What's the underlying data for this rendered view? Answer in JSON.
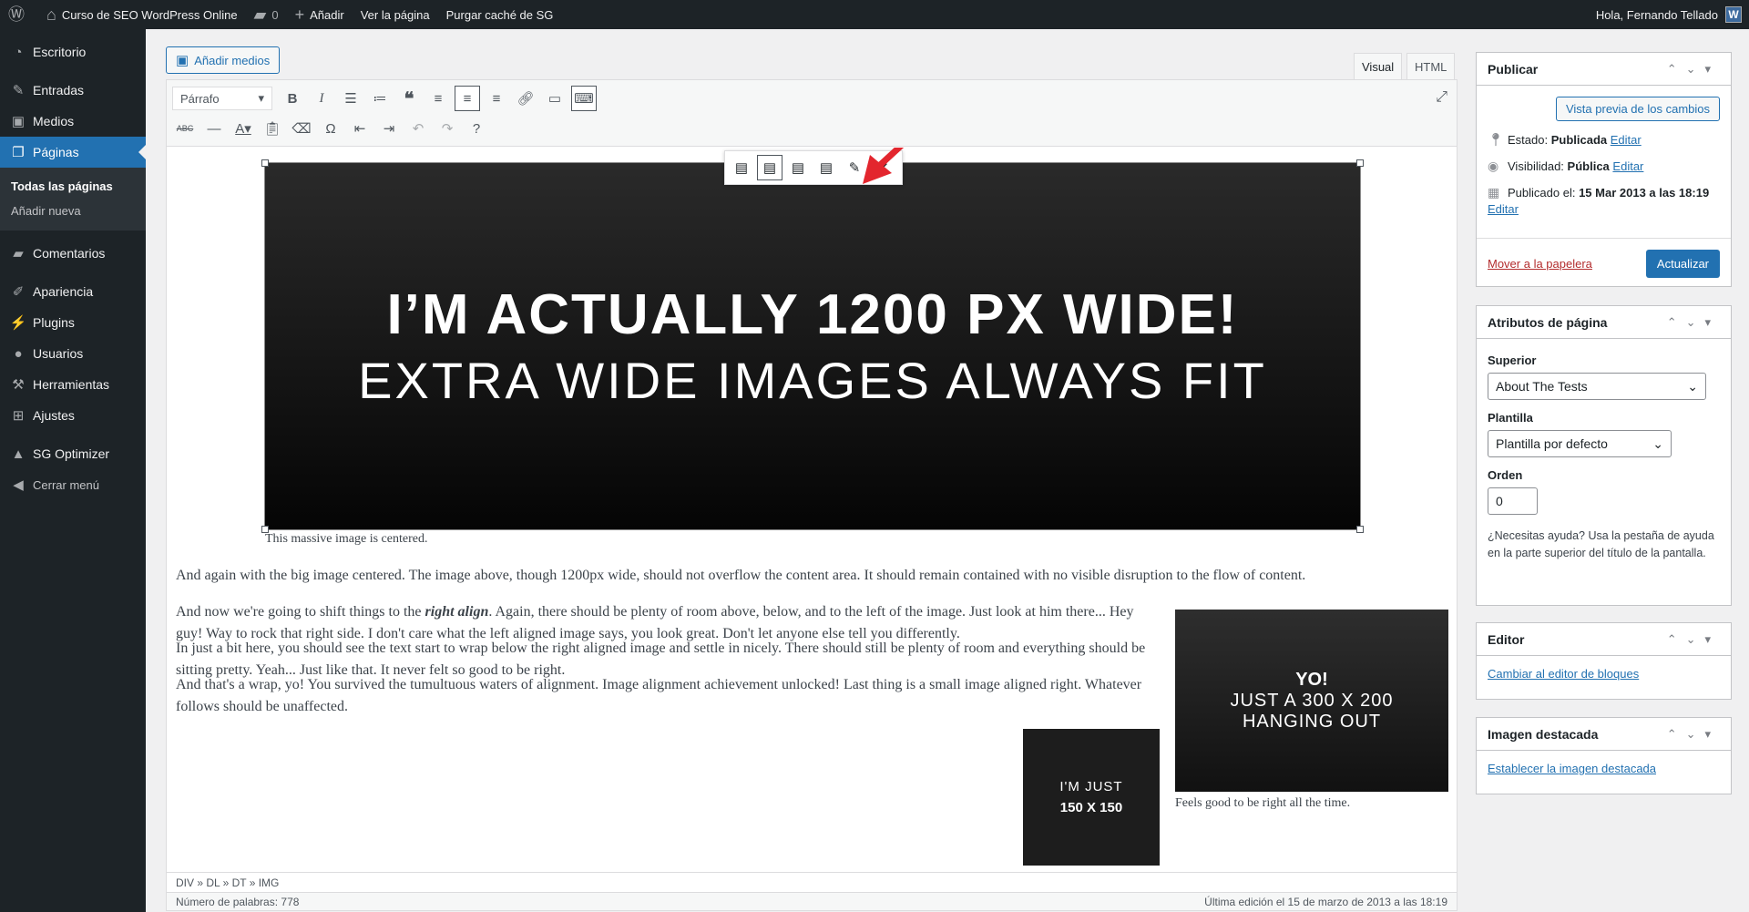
{
  "adminbar": {
    "site_name": "Curso de SEO WordPress Online",
    "comments_count": "0",
    "add_new": "Añadir",
    "view_page": "Ver la página",
    "purge_cache": "Purgar caché de SG",
    "greeting": "Hola, Fernando Tellado",
    "avatar_letter": "W"
  },
  "menu": {
    "dashboard": "Escritorio",
    "posts": "Entradas",
    "media": "Medios",
    "pages": "Páginas",
    "pages_sub": [
      "Todas las páginas",
      "Añadir nueva"
    ],
    "comments": "Comentarios",
    "appearance": "Apariencia",
    "plugins": "Plugins",
    "users": "Usuarios",
    "tools": "Herramientas",
    "settings": "Ajustes",
    "sg_optimizer": "SG Optimizer",
    "collapse": "Cerrar menú"
  },
  "editor": {
    "add_media": "Añadir medios",
    "tab_visual": "Visual",
    "tab_html": "HTML",
    "format_select": "Párrafo",
    "big_image_line1": "I’M ACTUALLY 1200 PX WIDE!",
    "big_image_line2": "EXTRA WIDE IMAGES ALWAYS FIT",
    "big_caption": "This massive image is centered.",
    "p1": "And again with the big image centered. The image above, though 1200px wide, should not overflow the content area. It should remain contained with no visible disruption to the flow of content.",
    "p2_before": "And now we're going to shift things to the ",
    "p2_em": "right align",
    "p2_after": ". Again, there should be plenty of room above, below, and to the left of the image. Just look at him there... Hey guy! Way to rock that right side. I don't care what the left aligned image says, you look great. Don't let anyone else tell you differently.",
    "p3": "In just a bit here, you should see the text start to wrap below the right aligned image and settle in nicely. There should still be plenty of room and everything should be sitting pretty. Yeah... Just like that. It never felt so good to be right.",
    "p4": "And that's a wrap, yo! You survived the tumultuous waters of alignment. Image alignment achievement unlocked! Last thing is a small image aligned right. Whatever follows should be unaffected.",
    "right_image_line1": "YO!",
    "right_image_line2": "JUST A 300 X 200",
    "right_image_line3": "HANGING OUT",
    "right_caption": "Feels good to be right all the time.",
    "small_image_line1": "I'M JUST",
    "small_image_line2": "150 X 150",
    "path": "DIV » DL » DT » IMG",
    "word_count": "Número de palabras: 778",
    "last_edit": "Última edición el 15 de marzo de 2013 a las 18:19"
  },
  "publish": {
    "title": "Publicar",
    "preview": "Vista previa de los cambios",
    "status_label": "Estado:",
    "status_value": "Publicada",
    "visibility_label": "Visibilidad:",
    "visibility_value": "Pública",
    "published_label": "Publicado el:",
    "published_value": "15 Mar 2013 a las 18:19",
    "edit": "Editar",
    "trash": "Mover a la papelera",
    "update": "Actualizar"
  },
  "attributes": {
    "title": "Atributos de página",
    "parent_label": "Superior",
    "parent_value": "About The Tests",
    "template_label": "Plantilla",
    "template_value": "Plantilla por defecto",
    "order_label": "Orden",
    "order_value": "0",
    "help": "¿Necesitas ayuda? Usa la pestaña de ayuda en la parte superior del título de la pantalla."
  },
  "editor_box": {
    "title": "Editor",
    "link": "Cambiar al editor de bloques"
  },
  "featured": {
    "title": "Imagen destacada",
    "link": "Establecer la imagen destacada"
  },
  "colors": {
    "accent": "#2271b1",
    "adminbar": "#1d2327",
    "arrow": "#e3262e"
  }
}
